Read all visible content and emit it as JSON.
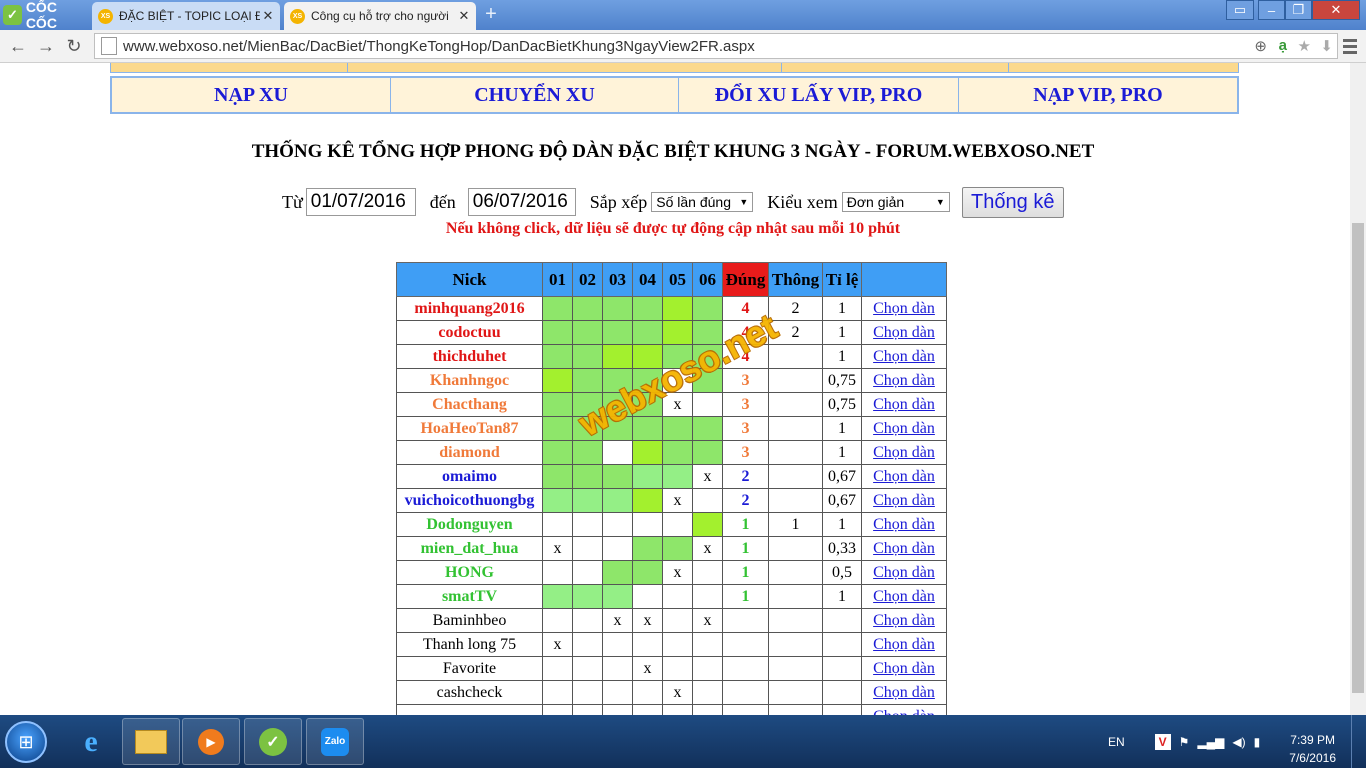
{
  "browser": {
    "logo_text": "CỐC CỐC",
    "tabs": [
      {
        "label": "ĐẶC BIỆT - TOPIC LOẠI ĐẶ",
        "favicon": "XS"
      },
      {
        "label": "Công cụ hỗ trợ cho người",
        "favicon": "XS"
      }
    ],
    "url": "www.webxoso.net/MienBac/DacBiet/ThongKeTongHop/DanDacBietKhung3NgayView2FR.aspx"
  },
  "menu": [
    "NẠP XU",
    "CHUYỂN XU",
    "ĐỔI XU LẤY VIP, PRO",
    "NẠP VIP, PRO"
  ],
  "heading": "THỐNG KÊ TỔNG HỢP PHONG ĐỘ DÀN ĐẶC BIỆT KHUNG 3 NGÀY - FORUM.WEBXOSO.NET",
  "form": {
    "from_label": "Từ",
    "from_value": "01/07/2016",
    "to_label": "đến",
    "to_value": "06/07/2016",
    "sort_label": "Sắp xếp",
    "sort_value": "Số lần đúng",
    "view_label": "Kiểu xem",
    "view_value": "Đơn giản",
    "submit_label": "Thống kê"
  },
  "notice": "Nếu không click, dữ liệu sẽ được tự động cập nhật sau mỗi 10 phút",
  "table": {
    "headers": [
      "Nick",
      "01",
      "02",
      "03",
      "04",
      "05",
      "06",
      "Đúng",
      "Thông",
      "Tỉ lệ",
      ""
    ],
    "link_label": "Chọn dàn",
    "colors": {
      "red": "#e01616",
      "orange": "#f07a3a",
      "blue": "#1b1bd6",
      "green": "#33c233",
      "black": "#000000"
    },
    "rows": [
      {
        "nick": "minhquang2016",
        "color": "red",
        "bold": true,
        "days": [
          "g1",
          "g1",
          "g1",
          "g1",
          "g2",
          "g1"
        ],
        "marks": [
          "",
          "",
          "",
          "",
          "",
          ""
        ],
        "dung": "4",
        "thong": "2",
        "tile": "1"
      },
      {
        "nick": "codoctuu",
        "color": "red",
        "bold": true,
        "days": [
          "g1",
          "g1",
          "g1",
          "g1",
          "g2",
          "g1"
        ],
        "marks": [
          "",
          "",
          "",
          "",
          "",
          ""
        ],
        "dung": "4",
        "thong": "2",
        "tile": "1"
      },
      {
        "nick": "thichduhet",
        "color": "red",
        "bold": true,
        "days": [
          "g1",
          "g1",
          "g2",
          "g2",
          "g1",
          "g1"
        ],
        "marks": [
          "",
          "",
          "",
          "",
          "",
          ""
        ],
        "dung": "4",
        "thong": "",
        "tile": "1"
      },
      {
        "nick": "Khanhngoc",
        "color": "orange",
        "bold": true,
        "days": [
          "g2",
          "g1",
          "g1",
          "g1",
          "",
          "g1"
        ],
        "marks": [
          "",
          "",
          "",
          "",
          "",
          ""
        ],
        "dung": "3",
        "thong": "",
        "tile": "0,75"
      },
      {
        "nick": "Chacthang",
        "color": "orange",
        "bold": true,
        "days": [
          "g1",
          "g1",
          "g1",
          "g1",
          "",
          ""
        ],
        "marks": [
          "",
          "",
          "",
          "",
          "x",
          ""
        ],
        "dung": "3",
        "thong": "",
        "tile": "0,75"
      },
      {
        "nick": "HoaHeoTan87",
        "color": "orange",
        "bold": true,
        "days": [
          "g1",
          "g1",
          "g1",
          "g1",
          "g1",
          "g1"
        ],
        "marks": [
          "",
          "",
          "",
          "",
          "",
          ""
        ],
        "dung": "3",
        "thong": "",
        "tile": "1"
      },
      {
        "nick": "diamond",
        "color": "orange",
        "bold": true,
        "days": [
          "g1",
          "g1",
          "",
          "g2",
          "g1",
          "g1"
        ],
        "marks": [
          "",
          "",
          "",
          "",
          "",
          ""
        ],
        "dung": "3",
        "thong": "",
        "tile": "1"
      },
      {
        "nick": "omaimo",
        "color": "blue",
        "bold": true,
        "days": [
          "g1",
          "g1",
          "g1",
          "g3",
          "g3",
          ""
        ],
        "marks": [
          "",
          "",
          "",
          "",
          "",
          "x"
        ],
        "dung": "2",
        "thong": "",
        "tile": "0,67"
      },
      {
        "nick": "vuichoicothuongbg",
        "color": "blue",
        "bold": true,
        "days": [
          "g3",
          "g3",
          "g3",
          "g2",
          "",
          ""
        ],
        "marks": [
          "",
          "",
          "",
          "",
          "x",
          ""
        ],
        "dung": "2",
        "thong": "",
        "tile": "0,67"
      },
      {
        "nick": "Dodonguyen",
        "color": "green",
        "bold": true,
        "days": [
          "",
          "",
          "",
          "",
          "",
          "g2"
        ],
        "marks": [
          "",
          "",
          "",
          "",
          "",
          ""
        ],
        "dung": "1",
        "thong": "1",
        "tile": "1"
      },
      {
        "nick": "mien_dat_hua",
        "color": "green",
        "bold": true,
        "days": [
          "",
          "",
          "",
          "g1",
          "g1",
          ""
        ],
        "marks": [
          "x",
          "",
          "",
          "",
          "",
          "x"
        ],
        "dung": "1",
        "thong": "",
        "tile": "0,33"
      },
      {
        "nick": "HONG",
        "color": "green",
        "bold": true,
        "days": [
          "",
          "",
          "g1",
          "g1",
          "",
          ""
        ],
        "marks": [
          "",
          "",
          "",
          "",
          "x",
          ""
        ],
        "dung": "1",
        "thong": "",
        "tile": "0,5"
      },
      {
        "nick": "smatTV",
        "color": "green",
        "bold": true,
        "days": [
          "g3",
          "g3",
          "g3",
          "",
          "",
          ""
        ],
        "marks": [
          "",
          "",
          "",
          "",
          "",
          ""
        ],
        "dung": "1",
        "thong": "",
        "tile": "1"
      },
      {
        "nick": "Baminhbeo",
        "color": "black",
        "bold": false,
        "days": [
          "",
          "",
          "",
          "",
          "",
          ""
        ],
        "marks": [
          "",
          "",
          "x",
          "x",
          "",
          "x"
        ],
        "dung": "",
        "thong": "",
        "tile": ""
      },
      {
        "nick": "Thanh long 75",
        "color": "black",
        "bold": false,
        "days": [
          "",
          "",
          "",
          "",
          "",
          ""
        ],
        "marks": [
          "x",
          "",
          "",
          "",
          "",
          ""
        ],
        "dung": "",
        "thong": "",
        "tile": ""
      },
      {
        "nick": "Favorite",
        "color": "black",
        "bold": false,
        "days": [
          "",
          "",
          "",
          "",
          "",
          ""
        ],
        "marks": [
          "",
          "",
          "",
          "x",
          "",
          ""
        ],
        "dung": "",
        "thong": "",
        "tile": ""
      },
      {
        "nick": "cashcheck",
        "color": "black",
        "bold": false,
        "days": [
          "",
          "",
          "",
          "",
          "",
          ""
        ],
        "marks": [
          "",
          "",
          "",
          "",
          "x",
          ""
        ],
        "dung": "",
        "thong": "",
        "tile": ""
      },
      {
        "nick": "",
        "color": "black",
        "bold": false,
        "days": [
          "",
          "",
          "",
          "",
          "",
          ""
        ],
        "marks": [
          "",
          "",
          "",
          "",
          "",
          ""
        ],
        "dung": "",
        "thong": "",
        "tile": ""
      }
    ]
  },
  "watermark": "webxoso.net",
  "taskbar": {
    "language": "EN",
    "time": "7:39 PM",
    "date": "7/6/2016"
  }
}
